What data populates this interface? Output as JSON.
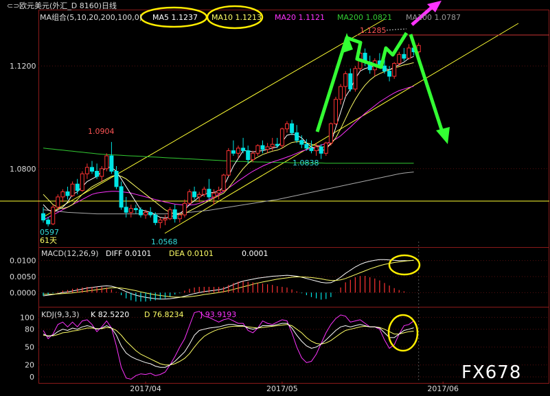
{
  "header": {
    "symbol": "欧元美元(外汇_D 8160)日线",
    "ma_group": "MA组合(5,10,20,200,100,0)",
    "ma5": "MA5 1.1237",
    "ma10": "MA10 1.1213",
    "ma20": "MA20 1.1121",
    "ma200": "MA200 1.0821",
    "ma100": "MA100 1.0787"
  },
  "macd_header": {
    "title": "MACD(12,26,9)",
    "diff": "DIFF  0.0101",
    "dea": "DEA  0.0101",
    "macd": "0.0001"
  },
  "kdj_header": {
    "title": "KDJ(9,3,3)",
    "k": "K  82.5220",
    "d": "D  76.8234",
    "j": "J  93.9193"
  },
  "annotations": {
    "high_1": "1.0904",
    "low_1": "1.0568",
    "low_2": "1.0838",
    "high_2": "1.1285",
    "left_low": "0597",
    "left_days": "61天"
  },
  "watermark": "FX678",
  "colors": {
    "ma5": "#ffffff",
    "ma10": "#ffff66",
    "ma20": "#ff33ff",
    "ma200": "#33cc33",
    "ma100": "#aaaaaa",
    "up": "#ff3333",
    "down": "#00e5e5",
    "arrow_green": "#33ff33",
    "arrow_magenta": "#ff33ff",
    "highlight": "#ffee00"
  },
  "chart_data": {
    "type": "candlestick",
    "price_axis": {
      "ticks": [
        "1.1200",
        "1.0800"
      ],
      "ylim": [
        1.05,
        1.135
      ]
    },
    "macd_axis": {
      "ticks": [
        "0.0100",
        "0.0050",
        "0.0000"
      ],
      "ylim": [
        -0.004,
        0.0125
      ]
    },
    "kdj_axis": {
      "ticks": [
        "100",
        "80",
        "50",
        "20",
        "0"
      ],
      "ylim": [
        -8,
        112
      ]
    },
    "x_ticks": [
      "2017/04",
      "2017/05",
      "2017/06"
    ],
    "x_tick_index": [
      21,
      49,
      82
    ],
    "candles": [
      [
        1.0625,
        1.065,
        1.059,
        1.06
      ],
      [
        1.06,
        1.0612,
        1.0575,
        1.0585
      ],
      [
        1.0585,
        1.066,
        1.058,
        1.065
      ],
      [
        1.065,
        1.07,
        1.064,
        1.069
      ],
      [
        1.069,
        1.072,
        1.067,
        1.071
      ],
      [
        1.071,
        1.073,
        1.068,
        1.0695
      ],
      [
        1.0695,
        1.075,
        1.069,
        1.074
      ],
      [
        1.074,
        1.076,
        1.07,
        1.0715
      ],
      [
        1.0715,
        1.079,
        1.071,
        1.078
      ],
      [
        1.078,
        1.082,
        1.076,
        1.0805
      ],
      [
        1.0805,
        1.083,
        1.078,
        1.079
      ],
      [
        1.079,
        1.082,
        1.076,
        1.077
      ],
      [
        1.077,
        1.081,
        1.075,
        1.08
      ],
      [
        1.08,
        1.086,
        1.079,
        1.085
      ],
      [
        1.085,
        1.0904,
        1.078,
        1.079
      ],
      [
        1.079,
        1.081,
        1.072,
        1.073
      ],
      [
        1.073,
        1.075,
        1.064,
        1.065
      ],
      [
        1.065,
        1.069,
        1.061,
        1.063
      ],
      [
        1.063,
        1.066,
        1.061,
        1.0645
      ],
      [
        1.0645,
        1.066,
        1.0625,
        1.064
      ],
      [
        1.064,
        1.065,
        1.061,
        1.062
      ],
      [
        1.062,
        1.064,
        1.0605,
        1.063
      ],
      [
        1.063,
        1.065,
        1.061,
        1.062
      ],
      [
        1.062,
        1.063,
        1.058,
        1.059
      ],
      [
        1.059,
        1.061,
        1.0568,
        1.06
      ],
      [
        1.06,
        1.062,
        1.058,
        1.0605
      ],
      [
        1.0605,
        1.065,
        1.06,
        1.064
      ],
      [
        1.064,
        1.066,
        1.059,
        1.0605
      ],
      [
        1.0605,
        1.063,
        1.059,
        1.062
      ],
      [
        1.062,
        1.068,
        1.061,
        1.0665
      ],
      [
        1.0665,
        1.072,
        1.066,
        1.071
      ],
      [
        1.071,
        1.073,
        1.068,
        1.069
      ],
      [
        1.069,
        1.071,
        1.067,
        1.07
      ],
      [
        1.07,
        1.073,
        1.069,
        1.072
      ],
      [
        1.072,
        1.076,
        1.068,
        1.069
      ],
      [
        1.069,
        1.072,
        1.066,
        1.0705
      ],
      [
        1.0705,
        1.073,
        1.068,
        1.0715
      ],
      [
        1.0715,
        1.078,
        1.071,
        1.0775
      ],
      [
        1.0775,
        1.088,
        1.077,
        1.087
      ],
      [
        1.087,
        1.091,
        1.085,
        1.086
      ],
      [
        1.086,
        1.089,
        1.084,
        1.088
      ],
      [
        1.088,
        1.092,
        1.086,
        1.087
      ],
      [
        1.087,
        1.089,
        1.082,
        1.0835
      ],
      [
        1.0835,
        1.087,
        1.0825,
        1.086
      ],
      [
        1.086,
        1.0895,
        1.085,
        1.089
      ],
      [
        1.089,
        1.091,
        1.086,
        1.0875
      ],
      [
        1.0875,
        1.09,
        1.086,
        1.0885
      ],
      [
        1.0885,
        1.092,
        1.087,
        1.0895
      ],
      [
        1.0895,
        1.092,
        1.088,
        1.089
      ],
      [
        1.089,
        1.096,
        1.088,
        1.0955
      ],
      [
        1.0955,
        1.0985,
        1.094,
        1.0975
      ],
      [
        1.0975,
        1.099,
        1.093,
        1.094
      ],
      [
        1.094,
        1.097,
        1.09,
        1.091
      ],
      [
        1.091,
        1.093,
        1.088,
        1.0895
      ],
      [
        1.0895,
        1.0915,
        1.087,
        1.088
      ],
      [
        1.088,
        1.091,
        1.086,
        1.087
      ],
      [
        1.087,
        1.09,
        1.085,
        1.0885
      ],
      [
        1.0885,
        1.0895,
        1.0838,
        1.086
      ],
      [
        1.086,
        1.0905,
        1.085,
        1.09
      ],
      [
        1.09,
        1.098,
        1.089,
        1.0975
      ],
      [
        1.0975,
        1.108,
        1.097,
        1.107
      ],
      [
        1.107,
        1.113,
        1.105,
        1.112
      ],
      [
        1.112,
        1.118,
        1.108,
        1.117
      ],
      [
        1.117,
        1.119,
        1.11,
        1.111
      ],
      [
        1.111,
        1.12,
        1.11,
        1.119
      ],
      [
        1.119,
        1.127,
        1.118,
        1.125
      ],
      [
        1.125,
        1.1268,
        1.12,
        1.1215
      ],
      [
        1.1215,
        1.124,
        1.117,
        1.1185
      ],
      [
        1.1185,
        1.123,
        1.116,
        1.122
      ],
      [
        1.122,
        1.125,
        1.119,
        1.12
      ],
      [
        1.12,
        1.1225,
        1.117,
        1.118
      ],
      [
        1.118,
        1.12,
        1.114,
        1.116
      ],
      [
        1.116,
        1.1215,
        1.115,
        1.121
      ],
      [
        1.121,
        1.1255,
        1.12,
        1.1245
      ],
      [
        1.1245,
        1.127,
        1.122,
        1.123
      ],
      [
        1.123,
        1.1285,
        1.1225,
        1.127
      ],
      [
        1.127,
        1.1285,
        1.124,
        1.1255
      ],
      [
        1.1255,
        1.129,
        1.124,
        1.128
      ]
    ],
    "ma5": [
      1.066,
      1.064,
      1.063,
      1.064,
      1.065,
      1.067,
      1.07,
      1.071,
      1.073,
      1.075,
      1.076,
      1.077,
      1.079,
      1.0805,
      1.0805,
      1.079,
      1.076,
      1.073,
      1.07,
      1.067,
      1.064,
      1.0635,
      1.063,
      1.062,
      1.061,
      1.0608,
      1.0612,
      1.0618,
      1.0625,
      1.064,
      1.066,
      1.0675,
      1.069,
      1.07,
      1.0705,
      1.0708,
      1.0712,
      1.073,
      1.077,
      1.081,
      1.084,
      1.087,
      1.087,
      1.0865,
      1.0868,
      1.087,
      1.0875,
      1.088,
      1.0885,
      1.0905,
      1.093,
      1.0935,
      1.093,
      1.092,
      1.09,
      1.0885,
      1.0875,
      1.087,
      1.0875,
      1.09,
      1.096,
      1.102,
      1.108,
      1.111,
      1.115,
      1.118,
      1.119,
      1.1195,
      1.12,
      1.1195,
      1.119,
      1.1185,
      1.1195,
      1.1205,
      1.1215,
      1.123,
      1.1237
    ],
    "ma10": [
      1.07,
      1.068,
      1.066,
      1.065,
      1.0645,
      1.065,
      1.066,
      1.068,
      1.07,
      1.0715,
      1.073,
      1.074,
      1.075,
      1.076,
      1.077,
      1.0775,
      1.077,
      1.076,
      1.0745,
      1.073,
      1.0715,
      1.07,
      1.0685,
      1.067,
      1.0655,
      1.064,
      1.063,
      1.0625,
      1.0622,
      1.0625,
      1.0635,
      1.0645,
      1.0655,
      1.0665,
      1.0675,
      1.0685,
      1.0695,
      1.0705,
      1.0725,
      1.075,
      1.0775,
      1.08,
      1.082,
      1.0835,
      1.0845,
      1.0855,
      1.0862,
      1.0868,
      1.0872,
      1.088,
      1.0892,
      1.0902,
      1.0905,
      1.0905,
      1.09,
      1.0895,
      1.089,
      1.0885,
      1.0885,
      1.0895,
      1.092,
      1.0955,
      1.0995,
      1.1035,
      1.107,
      1.11,
      1.1125,
      1.1145,
      1.116,
      1.117,
      1.1178,
      1.1185,
      1.1192,
      1.1198,
      1.1204,
      1.1208,
      1.1213
    ],
    "ma20": [
      1.06,
      1.061,
      1.062,
      1.063,
      1.064,
      1.065,
      1.066,
      1.067,
      1.068,
      1.069,
      1.07,
      1.0705,
      1.0708,
      1.071,
      1.0712,
      1.0712,
      1.071,
      1.0708,
      1.0705,
      1.07,
      1.0695,
      1.069,
      1.0685,
      1.068,
      1.0675,
      1.067,
      1.0666,
      1.0662,
      1.066,
      1.0658,
      1.0658,
      1.066,
      1.0665,
      1.0672,
      1.068,
      1.069,
      1.07,
      1.0712,
      1.0725,
      1.0738,
      1.0752,
      1.0765,
      1.0778,
      1.079,
      1.08,
      1.081,
      1.0818,
      1.0826,
      1.0832,
      1.0838,
      1.0845,
      1.0852,
      1.086,
      1.0868,
      1.0874,
      1.088,
      1.0886,
      1.0892,
      1.0898,
      1.0905,
      1.0915,
      1.0928,
      1.0945,
      1.0962,
      1.098,
      1.0998,
      1.1015,
      1.103,
      1.1045,
      1.106,
      1.1072,
      1.1084,
      1.1095,
      1.1104,
      1.111,
      1.1116,
      1.1121
    ],
    "ma200": [
      1.088,
      1.0878,
      1.0876,
      1.0874,
      1.0872,
      1.087,
      1.0868,
      1.0866,
      1.0864,
      1.0862,
      1.086,
      1.0858,
      1.0856,
      1.0855,
      1.0854,
      1.0853,
      1.0852,
      1.0851,
      1.085,
      1.0849,
      1.0848,
      1.0847,
      1.0846,
      1.0845,
      1.0844,
      1.0843,
      1.0842,
      1.0841,
      1.084,
      1.0839,
      1.0838,
      1.0837,
      1.0836,
      1.0835,
      1.0834,
      1.0833,
      1.0832,
      1.0831,
      1.083,
      1.0829,
      1.0828,
      1.0828,
      1.0827,
      1.0827,
      1.0826,
      1.0826,
      1.0825,
      1.0825,
      1.0824,
      1.0824,
      1.0824,
      1.0823,
      1.0823,
      1.0823,
      1.0822,
      1.0822,
      1.0822,
      1.0822,
      1.0821,
      1.0821,
      1.0821,
      1.0821,
      1.0821,
      1.0821,
      1.0821,
      1.0821,
      1.0821,
      1.0821,
      1.0821,
      1.0821,
      1.0821,
      1.0821,
      1.0821,
      1.0821,
      1.0821,
      1.0821,
      1.0821
    ],
    "ma100": [
      1.064,
      1.0638,
      1.0636,
      1.0634,
      1.0632,
      1.063,
      1.0629,
      1.0628,
      1.0627,
      1.0626,
      1.0625,
      1.0624,
      1.0624,
      1.0624,
      1.0624,
      1.0624,
      1.0624,
      1.0624,
      1.0624,
      1.0624,
      1.0624,
      1.0624,
      1.0624,
      1.0624,
      1.0624,
      1.0624,
      1.0625,
      1.0626,
      1.0627,
      1.0628,
      1.063,
      1.0632,
      1.0634,
      1.0636,
      1.0638,
      1.0641,
      1.0644,
      1.0647,
      1.065,
      1.0653,
      1.0656,
      1.0659,
      1.0662,
      1.0665,
      1.0668,
      1.0671,
      1.0674,
      1.0677,
      1.068,
      1.0684,
      1.0688,
      1.0692,
      1.0696,
      1.07,
      1.0704,
      1.0708,
      1.0712,
      1.0716,
      1.072,
      1.0724,
      1.0728,
      1.0732,
      1.0736,
      1.074,
      1.0744,
      1.0748,
      1.0752,
      1.0756,
      1.076,
      1.0764,
      1.0768,
      1.0772,
      1.0776,
      1.078,
      1.0783,
      1.0785,
      1.0787
    ],
    "macd_diff": [
      -0.001,
      -0.0008,
      -0.0006,
      -0.0003,
      0.0,
      0.0002,
      0.0005,
      0.0008,
      0.0011,
      0.0014,
      0.0016,
      0.0018,
      0.002,
      0.0021,
      0.002,
      0.0016,
      0.001,
      0.0003,
      -0.0003,
      -0.0008,
      -0.0012,
      -0.0015,
      -0.0017,
      -0.0019,
      -0.002,
      -0.002,
      -0.0019,
      -0.0017,
      -0.0015,
      -0.0011,
      -0.0007,
      -0.0003,
      0.0,
      0.0003,
      0.0005,
      0.0007,
      0.0009,
      0.0012,
      0.0018,
      0.0025,
      0.0031,
      0.0036,
      0.0039,
      0.0042,
      0.0045,
      0.0047,
      0.0049,
      0.0051,
      0.0052,
      0.0053,
      0.0054,
      0.0053,
      0.0051,
      0.0048,
      0.0044,
      0.004,
      0.0036,
      0.0032,
      0.003,
      0.0031,
      0.0038,
      0.0048,
      0.006,
      0.007,
      0.008,
      0.0088,
      0.0094,
      0.0098,
      0.0101,
      0.0103,
      0.0103,
      0.0102,
      0.0101,
      0.01,
      0.01,
      0.01,
      0.0101
    ],
    "macd_dea": [
      -0.0005,
      -0.0005,
      -0.0005,
      -0.0004,
      -0.0003,
      -0.0002,
      -0.0001,
      0.0001,
      0.0003,
      0.0005,
      0.0007,
      0.0009,
      0.0011,
      0.0013,
      0.0015,
      0.0015,
      0.0014,
      0.0012,
      0.0009,
      0.0006,
      0.0002,
      -0.0001,
      -0.0004,
      -0.0007,
      -0.0009,
      -0.0011,
      -0.0013,
      -0.0014,
      -0.0014,
      -0.0014,
      -0.0013,
      -0.0011,
      -0.0009,
      -0.0006,
      -0.0004,
      -0.0002,
      0.0,
      0.0003,
      0.0006,
      0.001,
      0.0014,
      0.0018,
      0.0022,
      0.0026,
      0.003,
      0.0033,
      0.0036,
      0.0039,
      0.0042,
      0.0044,
      0.0046,
      0.0048,
      0.0049,
      0.0049,
      0.0048,
      0.0047,
      0.0045,
      0.0043,
      0.004,
      0.0038,
      0.0038,
      0.004,
      0.0044,
      0.005,
      0.0056,
      0.0062,
      0.0068,
      0.0074,
      0.0079,
      0.0084,
      0.0088,
      0.0091,
      0.0094,
      0.0096,
      0.0098,
      0.01,
      0.0101
    ],
    "kdj_k": [
      72,
      68,
      70,
      76,
      80,
      78,
      82,
      80,
      84,
      86,
      84,
      80,
      82,
      86,
      82,
      70,
      52,
      40,
      34,
      30,
      27,
      24,
      22,
      18,
      16,
      16,
      20,
      26,
      34,
      42,
      55,
      70,
      78,
      80,
      82,
      83,
      84,
      86,
      88,
      88,
      86,
      86,
      82,
      80,
      82,
      86,
      86,
      86,
      88,
      90,
      90,
      82,
      70,
      60,
      52,
      48,
      50,
      55,
      62,
      70,
      78,
      84,
      86,
      84,
      86,
      88,
      86,
      84,
      84,
      82,
      74,
      66,
      66,
      72,
      78,
      80,
      82.5
    ],
    "kdj_d": [
      70,
      69,
      69,
      71,
      74,
      75,
      77,
      78,
      80,
      82,
      82,
      81,
      81,
      83,
      82,
      78,
      70,
      60,
      52,
      44,
      38,
      34,
      30,
      26,
      22,
      20,
      20,
      22,
      26,
      31,
      39,
      50,
      60,
      68,
      73,
      77,
      80,
      82,
      84,
      85,
      85,
      85,
      84,
      83,
      82,
      83,
      84,
      85,
      86,
      87,
      88,
      86,
      80,
      74,
      66,
      60,
      56,
      55,
      57,
      61,
      67,
      73,
      78,
      80,
      82,
      84,
      85,
      84,
      84,
      83,
      80,
      76,
      72,
      72,
      74,
      76,
      76.8
    ],
    "kdj_j": [
      78,
      64,
      72,
      88,
      92,
      84,
      92,
      84,
      94,
      96,
      88,
      76,
      84,
      94,
      82,
      52,
      16,
      -2,
      -4,
      2,
      5,
      4,
      6,
      2,
      4,
      8,
      20,
      34,
      50,
      64,
      86,
      108,
      110,
      102,
      100,
      96,
      92,
      96,
      98,
      94,
      90,
      90,
      78,
      74,
      82,
      94,
      90,
      88,
      92,
      96,
      94,
      74,
      50,
      32,
      24,
      26,
      38,
      56,
      74,
      88,
      98,
      104,
      102,
      92,
      94,
      96,
      90,
      84,
      84,
      80,
      62,
      48,
      54,
      72,
      86,
      88,
      93.9
    ]
  }
}
